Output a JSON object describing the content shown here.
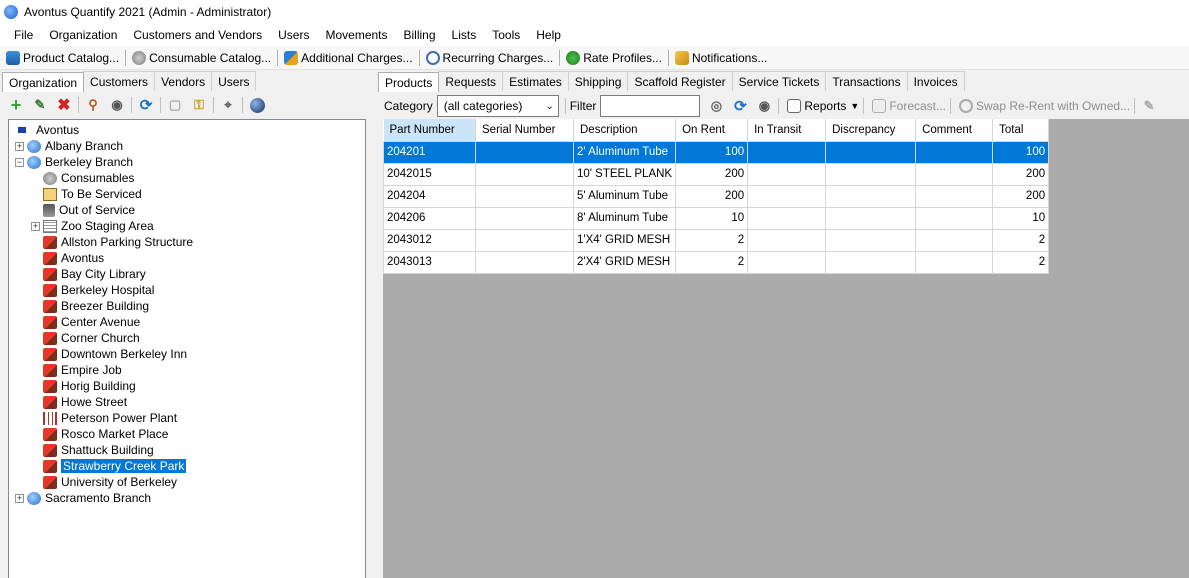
{
  "window": {
    "title": "Avontus Quantify 2021 (Admin - Administrator)"
  },
  "menu": [
    "File",
    "Organization",
    "Customers and Vendors",
    "Users",
    "Movements",
    "Billing",
    "Lists",
    "Tools",
    "Help"
  ],
  "commands": [
    {
      "label": "Product Catalog...",
      "icon": "product-catalog-icon"
    },
    {
      "label": "Consumable Catalog...",
      "icon": "consumable-catalog-icon"
    },
    {
      "label": "Additional Charges...",
      "icon": "additional-charges-icon"
    },
    {
      "label": "Recurring Charges...",
      "icon": "recurring-charges-icon"
    },
    {
      "label": "Rate Profiles...",
      "icon": "rate-profiles-icon"
    },
    {
      "label": "Notifications...",
      "icon": "notifications-icon"
    }
  ],
  "left_tabs": [
    "Organization",
    "Customers",
    "Vendors",
    "Users"
  ],
  "tree": {
    "root": "Avontus",
    "albany": "Albany Branch",
    "berkeley": "Berkeley Branch",
    "children": [
      "Consumables",
      "To Be Serviced",
      "Out of Service",
      "Zoo Staging Area",
      "Allston Parking Structure",
      "Avontus",
      "Bay City Library",
      "Berkeley Hospital",
      "Breezer Building",
      "Center Avenue",
      "Corner Church",
      "Downtown Berkeley Inn",
      "Empire Job",
      "Horig Building",
      "Howe Street",
      "Peterson Power Plant",
      "Rosco Market Place",
      "Shattuck Building",
      "Strawberry Creek Park",
      "University of Berkeley"
    ],
    "sacramento": "Sacramento Branch"
  },
  "right_tabs": [
    "Products",
    "Requests",
    "Estimates",
    "Shipping",
    "Scaffold Register",
    "Service Tickets",
    "Transactions",
    "Invoices"
  ],
  "toolbar": {
    "category_label": "Category",
    "category_value": "(all categories)",
    "filter_label": "Filter",
    "filter_value": "",
    "reports_label": "Reports",
    "forecast_label": "Forecast...",
    "swap_label": "Swap Re-Rent with Owned..."
  },
  "table": {
    "columns": [
      "Part Number",
      "Serial Number",
      "Description",
      "On Rent",
      "In Transit",
      "Discrepancy",
      "Comment",
      "Total"
    ],
    "rows": [
      [
        "204201",
        "",
        "2' Aluminum Tube",
        "100",
        "",
        "",
        "",
        "100"
      ],
      [
        "2042015",
        "",
        "10' STEEL PLANK",
        "200",
        "",
        "",
        "",
        "200"
      ],
      [
        "204204",
        "",
        "5' Aluminum Tube",
        "200",
        "",
        "",
        "",
        "200"
      ],
      [
        "204206",
        "",
        "8' Aluminum Tube",
        "10",
        "",
        "",
        "",
        "10"
      ],
      [
        "2043012",
        "",
        "1'X4' GRID MESH",
        "2",
        "",
        "",
        "",
        "2"
      ],
      [
        "2043013",
        "",
        "2'X4' GRID MESH",
        "2",
        "",
        "",
        "",
        "2"
      ]
    ]
  },
  "colors": {
    "selection": "#0078d7",
    "grid_background": "#ababab",
    "header_highlight": "#cce4f7"
  }
}
